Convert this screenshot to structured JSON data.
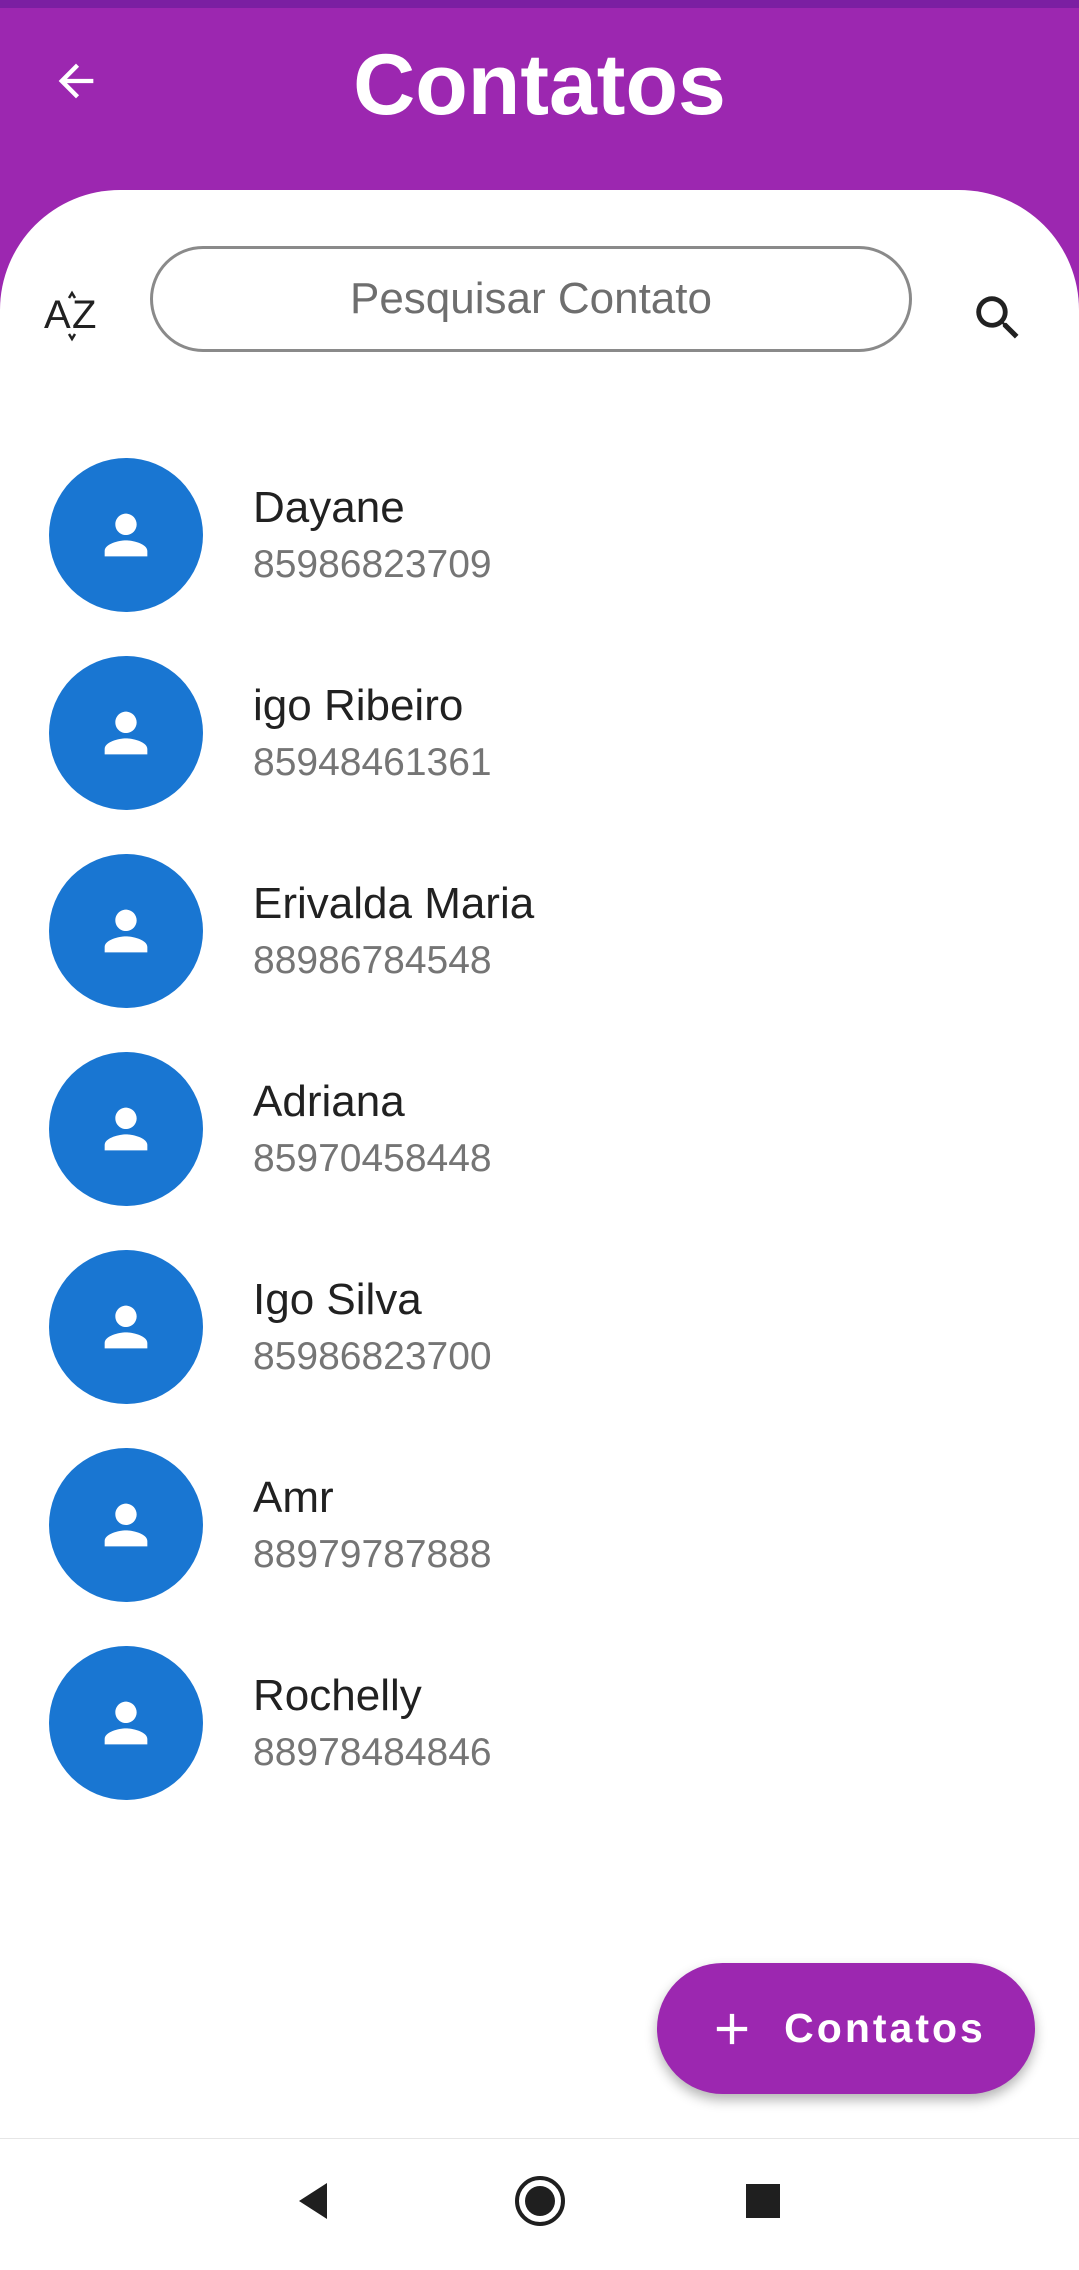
{
  "header": {
    "title": "Contatos",
    "back_icon": "arrow-back-icon",
    "background": "#9c27b0"
  },
  "toolbar": {
    "sort_icon": "sort-alphabetical-icon",
    "sort_label": "AZ",
    "search_placeholder": "Pesquisar Contato",
    "search_value": "",
    "search_icon": "search-icon"
  },
  "contacts": [
    {
      "name": "Dayane",
      "phone": "85986823709"
    },
    {
      "name": "igo Ribeiro",
      "phone": "85948461361"
    },
    {
      "name": "Erivalda Maria",
      "phone": "88986784548"
    },
    {
      "name": "Adriana",
      "phone": "85970458448"
    },
    {
      "name": "Igo Silva",
      "phone": "85986823700"
    },
    {
      "name": "Amr",
      "phone": "88979787888"
    },
    {
      "name": "Rochelly",
      "phone": "88978484846"
    }
  ],
  "avatar": {
    "icon": "person-icon",
    "color": "#1976d2"
  },
  "fab": {
    "label": "Contatos",
    "icon": "plus-icon",
    "color": "#9c27b0"
  },
  "navbar": {
    "back_icon": "nav-back-triangle-icon",
    "home_icon": "nav-home-circle-icon",
    "recents_icon": "nav-recents-square-icon"
  }
}
